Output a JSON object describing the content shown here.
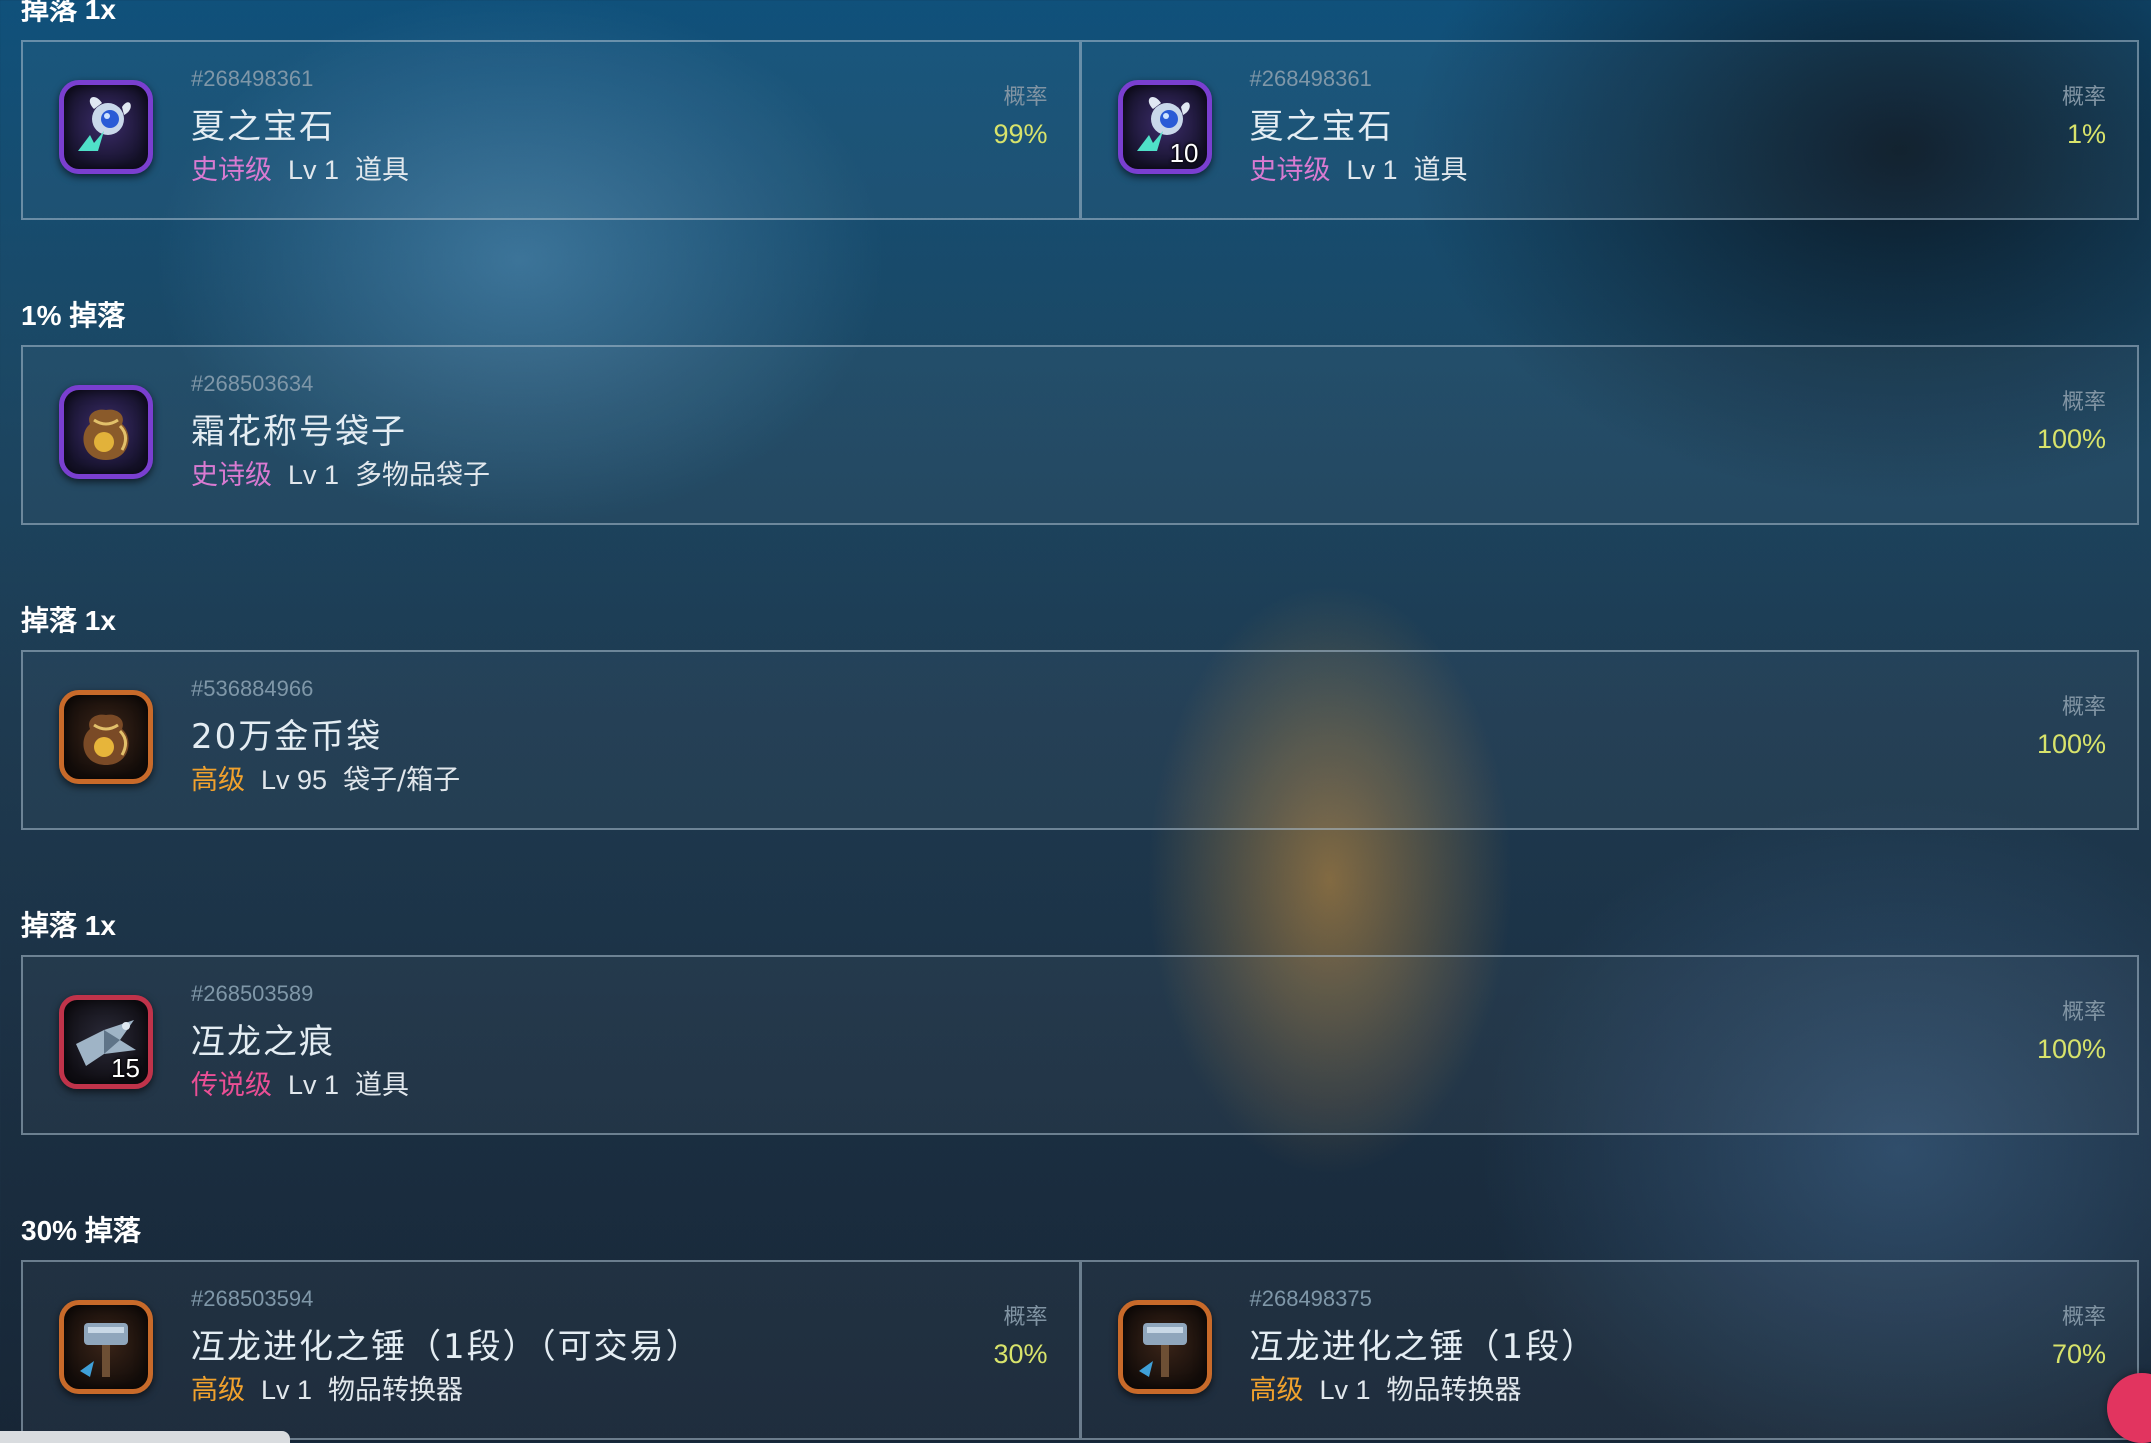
{
  "colors": {
    "epic": "#d97ad1",
    "legendary": "#ea4f95",
    "advanced": "#f0a12d",
    "probability": "#d8e36b"
  },
  "sections": [
    {
      "title": "掉落 1x",
      "cards": [
        {
          "id": "#268498361",
          "name": "夏之宝石",
          "rarity": "史诗级",
          "rarity_color": "#d97ad1",
          "level": "Lv 1",
          "type": "道具",
          "prob_label": "概率",
          "prob": "99%",
          "icon": "gem-flower-icon",
          "qty": ""
        },
        {
          "id": "#268498361",
          "name": "夏之宝石",
          "rarity": "史诗级",
          "rarity_color": "#d97ad1",
          "level": "Lv 1",
          "type": "道具",
          "prob_label": "概率",
          "prob": "1%",
          "icon": "gem-flower-icon",
          "qty": "10"
        }
      ]
    },
    {
      "title": "1% 掉落",
      "cards": [
        {
          "id": "#268503634",
          "name": "霜花称号袋子",
          "rarity": "史诗级",
          "rarity_color": "#d97ad1",
          "level": "Lv 1",
          "type": "多物品袋子",
          "prob_label": "概率",
          "prob": "100%",
          "icon": "bag-icon",
          "qty": ""
        }
      ]
    },
    {
      "title": "掉落 1x",
      "cards": [
        {
          "id": "#536884966",
          "name": "20万金币袋",
          "rarity": "高级",
          "rarity_color": "#f0a12d",
          "level": "Lv 95",
          "type": "袋子/箱子",
          "prob_label": "概率",
          "prob": "100%",
          "icon": "gold-bag-icon",
          "qty": ""
        }
      ]
    },
    {
      "title": "掉落 1x",
      "cards": [
        {
          "id": "#268503589",
          "name": "冱龙之痕",
          "rarity": "传说级",
          "rarity_color": "#ea4f95",
          "level": "Lv 1",
          "type": "道具",
          "prob_label": "概率",
          "prob": "100%",
          "icon": "dragon-shard-icon",
          "qty": "15"
        }
      ]
    },
    {
      "title": "30% 掉落",
      "cards": [
        {
          "id": "#268503594",
          "name": "冱龙进化之锤（1段）（可交易）",
          "rarity": "高级",
          "rarity_color": "#f0a12d",
          "level": "Lv 1",
          "type": "物品转换器",
          "prob_label": "概率",
          "prob": "30%",
          "icon": "hammer-icon",
          "qty": ""
        },
        {
          "id": "#268498375",
          "name": "冱龙进化之锤（1段）",
          "rarity": "高级",
          "rarity_color": "#f0a12d",
          "level": "Lv 1",
          "type": "物品转换器",
          "prob_label": "概率",
          "prob": "70%",
          "icon": "hammer-icon",
          "qty": ""
        }
      ]
    }
  ]
}
